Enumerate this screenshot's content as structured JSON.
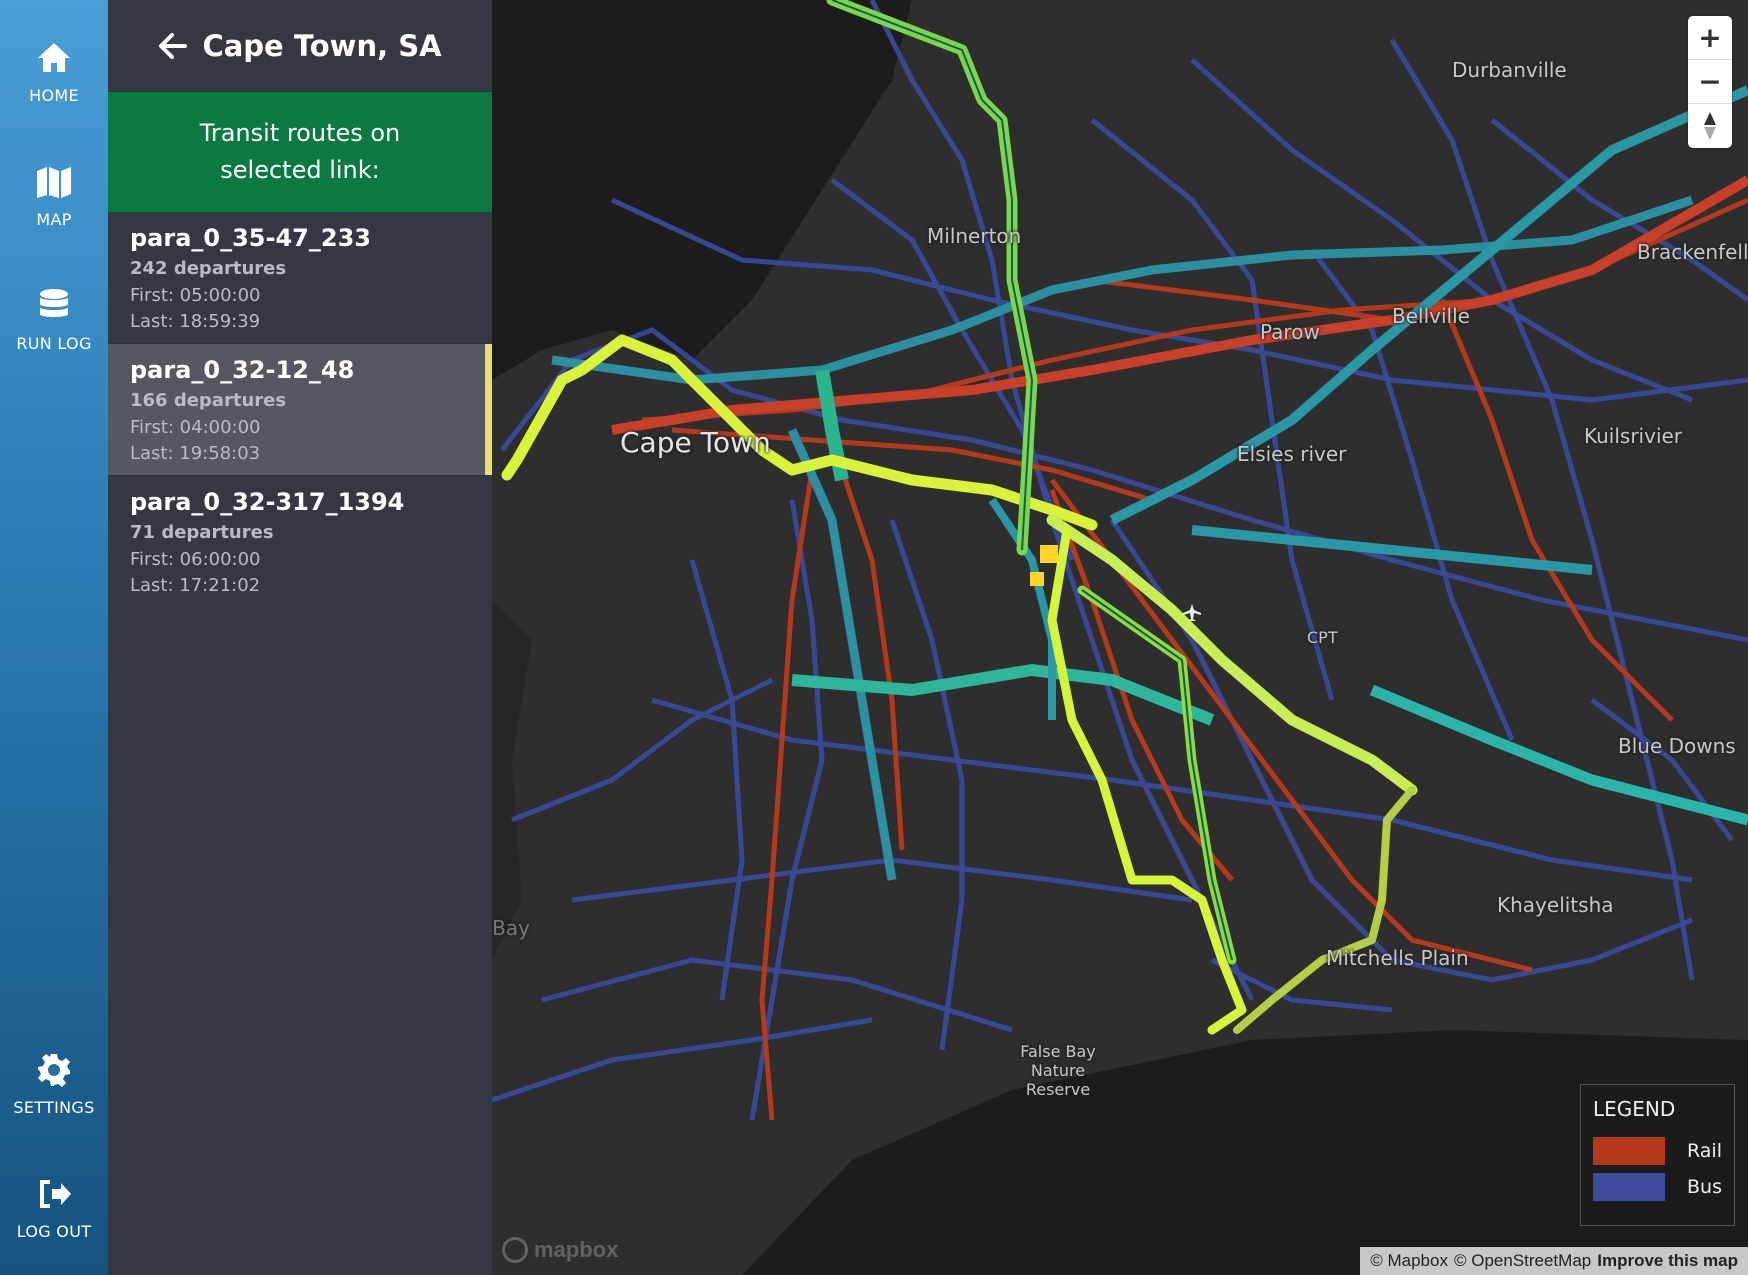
{
  "nav": {
    "home": "HOME",
    "map": "MAP",
    "run_log": "RUN LOG",
    "settings": "SETTINGS",
    "log_out": "LOG OUT"
  },
  "panel": {
    "title": "Cape Town, SA",
    "banner": "Transit routes on selected link:",
    "routes": [
      {
        "name": "para_0_35-47_233",
        "departures": "242 departures",
        "first": "First: 05:00:00",
        "last": "Last: 18:59:39"
      },
      {
        "name": "para_0_32-12_48",
        "departures": "166 departures",
        "first": "First: 04:00:00",
        "last": "Last: 19:58:03",
        "selected": true
      },
      {
        "name": "para_0_32-317_1394",
        "departures": "71 departures",
        "first": "First: 06:00:00",
        "last": "Last: 17:21:02"
      }
    ]
  },
  "map": {
    "places": {
      "durbanville": "Durbanville",
      "milnerton": "Milnerton",
      "brackenfell": "Brackenfell",
      "parow": "Parow",
      "bellville": "Bellville",
      "kuilsrivier": "Kuilsrivier",
      "cape_town": "Cape Town",
      "elsies_river": "Elsies river",
      "cpt": "CPT",
      "blue_downs": "Blue Downs",
      "hout_bay": "Hout Bay",
      "khayelitsha": "Khayelitsha",
      "mitchells_plain": "Mitchells Plain",
      "false_bay": "False Bay Nature Reserve"
    },
    "zoom": {
      "in": "+",
      "out": "−"
    },
    "legend": {
      "title": "LEGEND",
      "items": [
        {
          "label": "Rail",
          "color": "#b5391c"
        },
        {
          "label": "Bus",
          "color": "#3f4a9a"
        }
      ]
    },
    "attribution": {
      "mapbox": "© Mapbox",
      "osm": "© OpenStreetMap",
      "improve": "Improve this map"
    },
    "logo": "mapbox"
  }
}
